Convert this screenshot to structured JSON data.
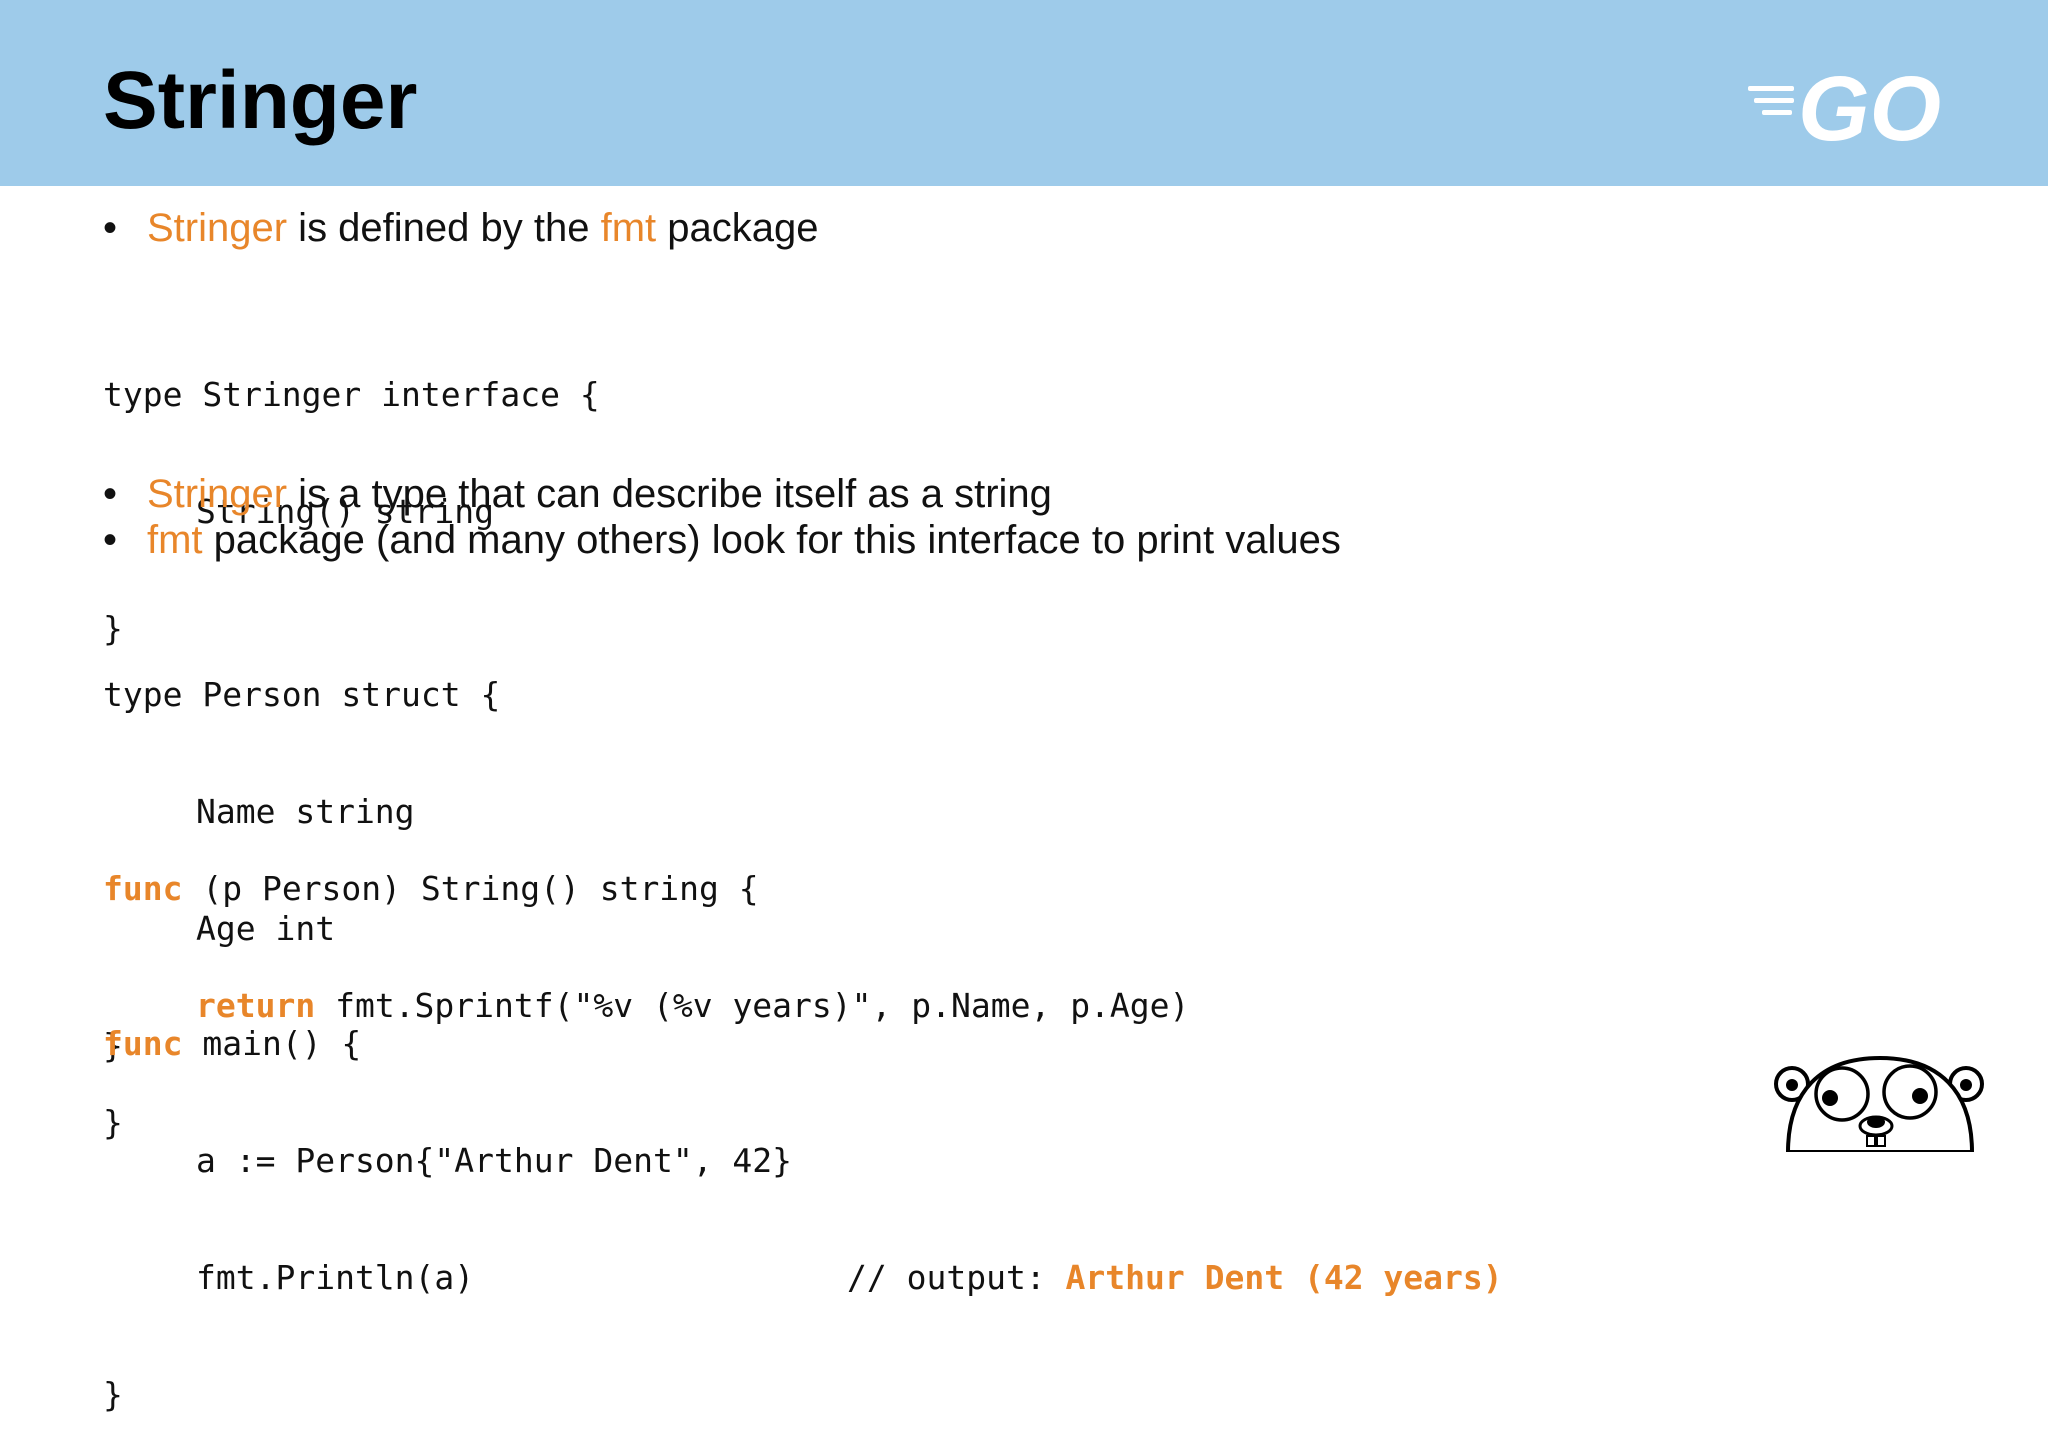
{
  "slide": {
    "title": "Stringer",
    "logo_text": "GO",
    "colors": {
      "header_bg": "#9ecbea",
      "accent": "#e8862a",
      "text": "#111111"
    }
  },
  "bullets": [
    {
      "parts": [
        "Stringer",
        " is defined by the ",
        "fmt",
        " package"
      ]
    },
    {
      "parts": [
        "Stringer",
        " is a type that can describe itself as a string"
      ]
    },
    {
      "parts": [
        "fmt",
        " package (and many others) look for this interface to print values"
      ]
    }
  ],
  "code": {
    "interface": [
      "type Stringer interface {",
      "String() string",
      "}"
    ],
    "struct": [
      "type Person struct {",
      "Name string",
      "Age int",
      "}"
    ],
    "method": {
      "kw_func": "func",
      "sig": " (p Person) String() string {",
      "kw_return": "return",
      "body": " fmt.Sprintf(\"%v (%v years)\", p.Name, p.Age)",
      "close": "}"
    },
    "main": {
      "kw_func": "func",
      "sig": " main() {",
      "line1": "a := Person{\"Arthur Dent\", 42}",
      "line2": "fmt.Println(a)",
      "comment": "// output: ",
      "output": "Arthur Dent (42 years)",
      "close": "}"
    }
  },
  "icons": {
    "logo": "go-logo-icon",
    "mascot": "gopher-mascot-icon"
  }
}
